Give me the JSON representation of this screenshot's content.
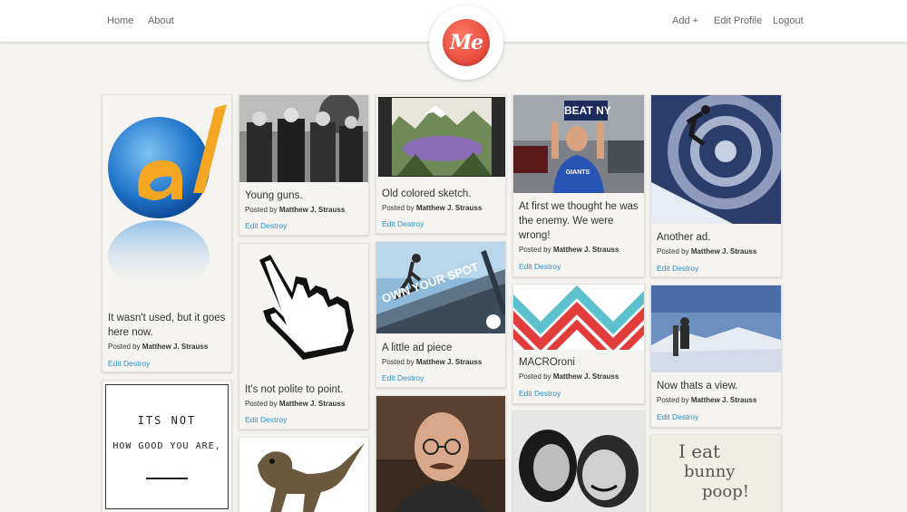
{
  "nav": {
    "home": "Home",
    "about": "About",
    "add": "Add +",
    "edit_profile": "Edit Profile",
    "logout": "Logout"
  },
  "logo": {
    "text": "Me",
    "color": "#e6483a"
  },
  "accent_link_color": "#2a8fc9",
  "pins": [
    {
      "caption": "It wasn't used, but it goes here now.",
      "posted_prefix": "Posted by",
      "author": "Matthew J. Strauss",
      "edit": "Edit",
      "destroy": "Destroy"
    },
    {
      "caption": "Young guns.",
      "posted_prefix": "Posted by",
      "author": "Matthew J. Strauss",
      "edit": "Edit",
      "destroy": "Destroy"
    },
    {
      "caption": "It's not polite to point.",
      "posted_prefix": "Posted by",
      "author": "Matthew J. Strauss",
      "edit": "Edit",
      "destroy": "Destroy"
    },
    {
      "caption": "Old colored sketch.",
      "posted_prefix": "Posted by",
      "author": "Matthew J. Strauss",
      "edit": "Edit",
      "destroy": "Destroy"
    },
    {
      "caption": "A little ad piece",
      "posted_prefix": "Posted by",
      "author": "Matthew J. Strauss",
      "edit": "Edit",
      "destroy": "Destroy"
    },
    {
      "caption": "At first we thought he was the enemy. We were wrong!",
      "posted_prefix": "Posted by",
      "author": "Matthew J. Strauss",
      "edit": "Edit",
      "destroy": "Destroy"
    },
    {
      "caption": "MACROroni",
      "posted_prefix": "Posted by",
      "author": "Matthew J. Strauss",
      "edit": "Edit",
      "destroy": "Destroy"
    },
    {
      "caption": "Another ad.",
      "posted_prefix": "Posted by",
      "author": "Matthew J. Strauss",
      "edit": "Edit",
      "destroy": "Destroy"
    },
    {
      "caption": "Now thats a view.",
      "posted_prefix": "Posted by",
      "author": "Matthew J. Strauss",
      "edit": "Edit",
      "destroy": "Destroy"
    }
  ],
  "image_text": {
    "poster_line1": "ITS NOT",
    "poster_line2": "HOW GOOD YOU ARE,",
    "sign": "BEAT NY",
    "shirt": "GIANTS",
    "ad_banner": "OWN YOUR SPOT",
    "note_line1": "I eat",
    "note_line2": "bunny",
    "note_line3": "poop!"
  }
}
